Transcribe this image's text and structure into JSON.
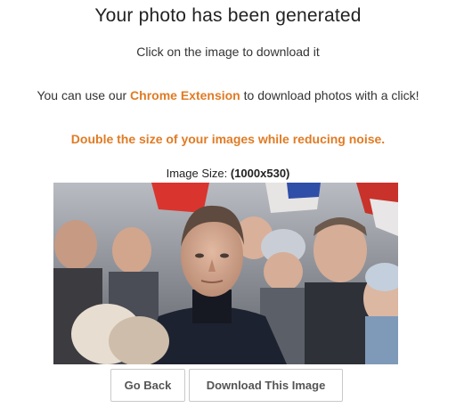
{
  "header": {
    "title": "Your photo has been generated",
    "subtitle": "Click on the image to download it"
  },
  "extension": {
    "prefix": "You can use our ",
    "link_label": "Chrome Extension",
    "suffix": " to download photos with a click!"
  },
  "promo": {
    "text": "Double the size of your images while reducing noise."
  },
  "image_info": {
    "label": "Image Size: ",
    "value": "(1000x530)"
  },
  "actions": {
    "back_label": "Go Back",
    "download_label": "Download This Image"
  },
  "colors": {
    "accent": "#e07b24",
    "text": "#222222",
    "button_border": "#c9c9c9",
    "button_text": "#555555"
  }
}
